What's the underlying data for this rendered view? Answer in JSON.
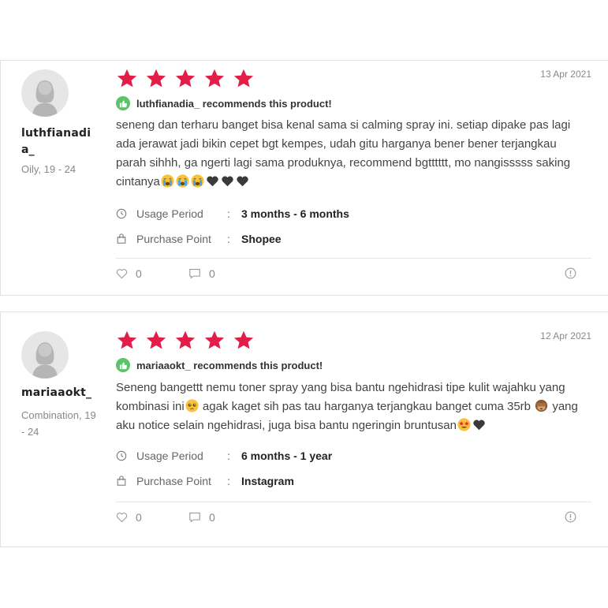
{
  "colors": {
    "star": "#e11d48",
    "recommend_badge": "#5cc36a",
    "text_muted": "#888888"
  },
  "icons": {
    "star": "star-icon",
    "recommend": "thumbs-up-icon",
    "usage": "clock-icon",
    "purchase": "shopping-bag-icon",
    "like": "heart-icon",
    "comment": "comment-icon",
    "report": "alert-circle-icon"
  },
  "reviews": [
    {
      "username": "luthfianadia_",
      "profile": "Oily, 19 - 24",
      "rating": 5,
      "date": "13 Apr 2021",
      "recommend": "luthfianadia_ recommends this product!",
      "text": "seneng dan terharu banget bisa kenal sama si calming spray ini. setiap dipake pas lagi ada jerawat jadi bikin cepet bgt kempes, udah gitu harganya bener bener terjangkau parah sihhh, ga ngerti lagi sama produknya, recommend bgtttttt, mo nangisssss saking cintanya",
      "emojis": [
        "crying-face",
        "crying-face",
        "crying-face",
        "black-heart",
        "black-heart",
        "black-heart"
      ],
      "usage_label": "Usage Period",
      "usage_value": "3 months - 6 months",
      "purchase_label": "Purchase Point",
      "purchase_value": "Shopee",
      "separator": ":",
      "likes": "0",
      "comments": "0"
    },
    {
      "username": "mariaaokt_",
      "profile": "Combination, 19 - 24",
      "rating": 5,
      "date": "12 Apr 2021",
      "recommend": "mariaaokt_ recommends this product!",
      "text_1": "Seneng bangettt nemu toner spray yang bisa bantu ngehidrasi tipe kulit wajahku yang kombinasi ini",
      "text_2": " agak kaget sih pas tau harganya terjangkau banget cuma 35rb ",
      "text_3": " yang aku notice selain ngehidrasi, juga bisa bantu ngeringin bruntusan",
      "emojis": [
        "pleading-face",
        "see-no-evil-monkey",
        "star-struck",
        "black-heart"
      ],
      "usage_label": "Usage Period",
      "usage_value": "6 months - 1 year",
      "purchase_label": "Purchase Point",
      "purchase_value": "Instagram",
      "separator": ":",
      "likes": "0",
      "comments": "0"
    }
  ]
}
